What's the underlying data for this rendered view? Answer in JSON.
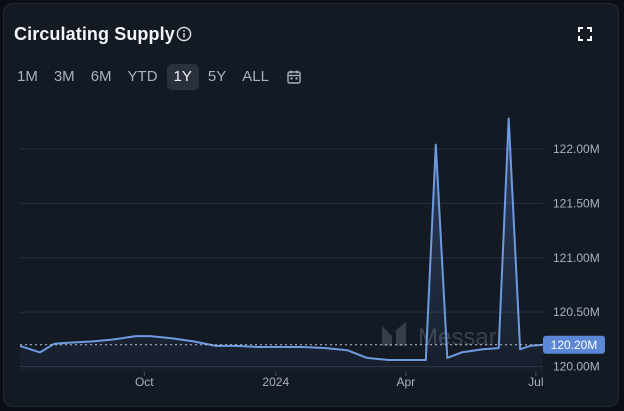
{
  "header": {
    "title": "Circulating Supply",
    "info_icon": "info-icon",
    "expand_icon": "expand-icon"
  },
  "ranges": [
    {
      "label": "1M",
      "active": false
    },
    {
      "label": "3M",
      "active": false
    },
    {
      "label": "6M",
      "active": false
    },
    {
      "label": "YTD",
      "active": false
    },
    {
      "label": "1Y",
      "active": true
    },
    {
      "label": "5Y",
      "active": false
    },
    {
      "label": "ALL",
      "active": false
    }
  ],
  "calendar_icon": "calendar-icon",
  "watermark": "Messari",
  "colors": {
    "line": "#6e9be0",
    "badge": "#5b87d6",
    "grid": "#273040",
    "background": "#141a24"
  },
  "chart_data": {
    "type": "area",
    "title": "Circulating Supply",
    "xlabel": "",
    "ylabel": "",
    "x": [
      "2023-07-06",
      "2023-07-20",
      "2023-07-30",
      "2023-08-10",
      "2023-08-25",
      "2023-09-10",
      "2023-09-25",
      "2023-10-05",
      "2023-10-20",
      "2023-11-05",
      "2023-11-20",
      "2023-12-05",
      "2023-12-20",
      "2024-01-05",
      "2024-01-20",
      "2024-02-05",
      "2024-02-20",
      "2024-03-05",
      "2024-03-20",
      "2024-04-01",
      "2024-04-15",
      "2024-04-22",
      "2024-04-30",
      "2024-05-10",
      "2024-05-25",
      "2024-06-05",
      "2024-06-12",
      "2024-06-20",
      "2024-06-27",
      "2024-07-06"
    ],
    "series": [
      {
        "values": [
          120.19,
          120.13,
          120.21,
          120.22,
          120.23,
          120.25,
          120.28,
          120.28,
          120.26,
          120.23,
          120.19,
          120.19,
          120.18,
          120.18,
          120.18,
          120.17,
          120.15,
          120.08,
          120.06,
          120.06,
          120.06,
          122.04,
          120.08,
          120.13,
          120.16,
          120.17,
          122.28,
          120.16,
          120.19,
          120.2
        ]
      }
    ],
    "xticks": [
      {
        "label": "Oct",
        "x": "2023-10-01"
      },
      {
        "label": "2024",
        "x": "2024-01-01"
      },
      {
        "label": "Apr",
        "x": "2024-04-01"
      },
      {
        "label": "Jul",
        "x": "2024-07-01"
      }
    ],
    "yticks": [
      120.0,
      120.5,
      121.0,
      121.5,
      122.0
    ],
    "ytick_labels": [
      "120.00M",
      "120.50M",
      "121.00M",
      "121.50M",
      "122.00M"
    ],
    "ylim": [
      119.95,
      122.45
    ],
    "current_value": 120.2,
    "current_label": "120.20M",
    "grid": true,
    "legend": "none"
  }
}
